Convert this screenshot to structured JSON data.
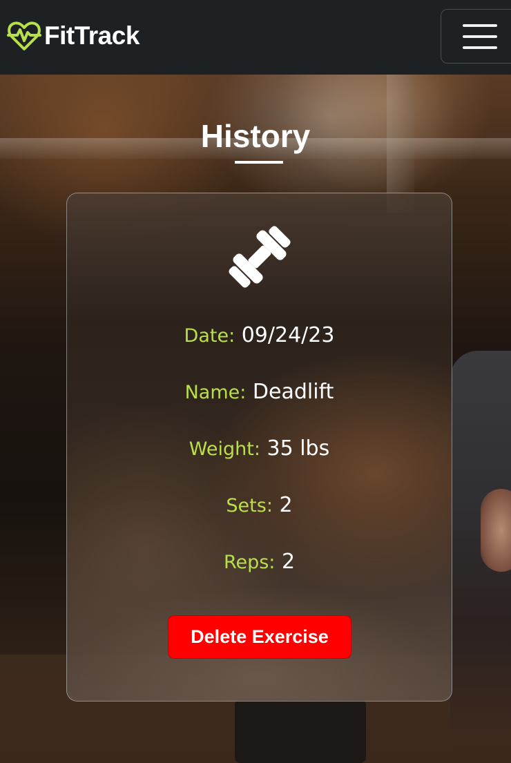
{
  "app": {
    "brand": "FitTrack",
    "logo_icon": "heart-pulse-icon",
    "menu_icon": "hamburger-menu-icon",
    "accent_color": "#b9e04a"
  },
  "page": {
    "title": "History"
  },
  "exercise_card": {
    "icon": "dumbbell-icon",
    "fields": [
      {
        "label": "Date:",
        "value": "09/24/23"
      },
      {
        "label": "Name:",
        "value": "Deadlift"
      },
      {
        "label": "Weight:",
        "value": "35 lbs"
      },
      {
        "label": "Sets:",
        "value": "2"
      },
      {
        "label": "Reps:",
        "value": "2"
      }
    ],
    "delete_label": "Delete Exercise",
    "delete_color": "#ff0000"
  }
}
